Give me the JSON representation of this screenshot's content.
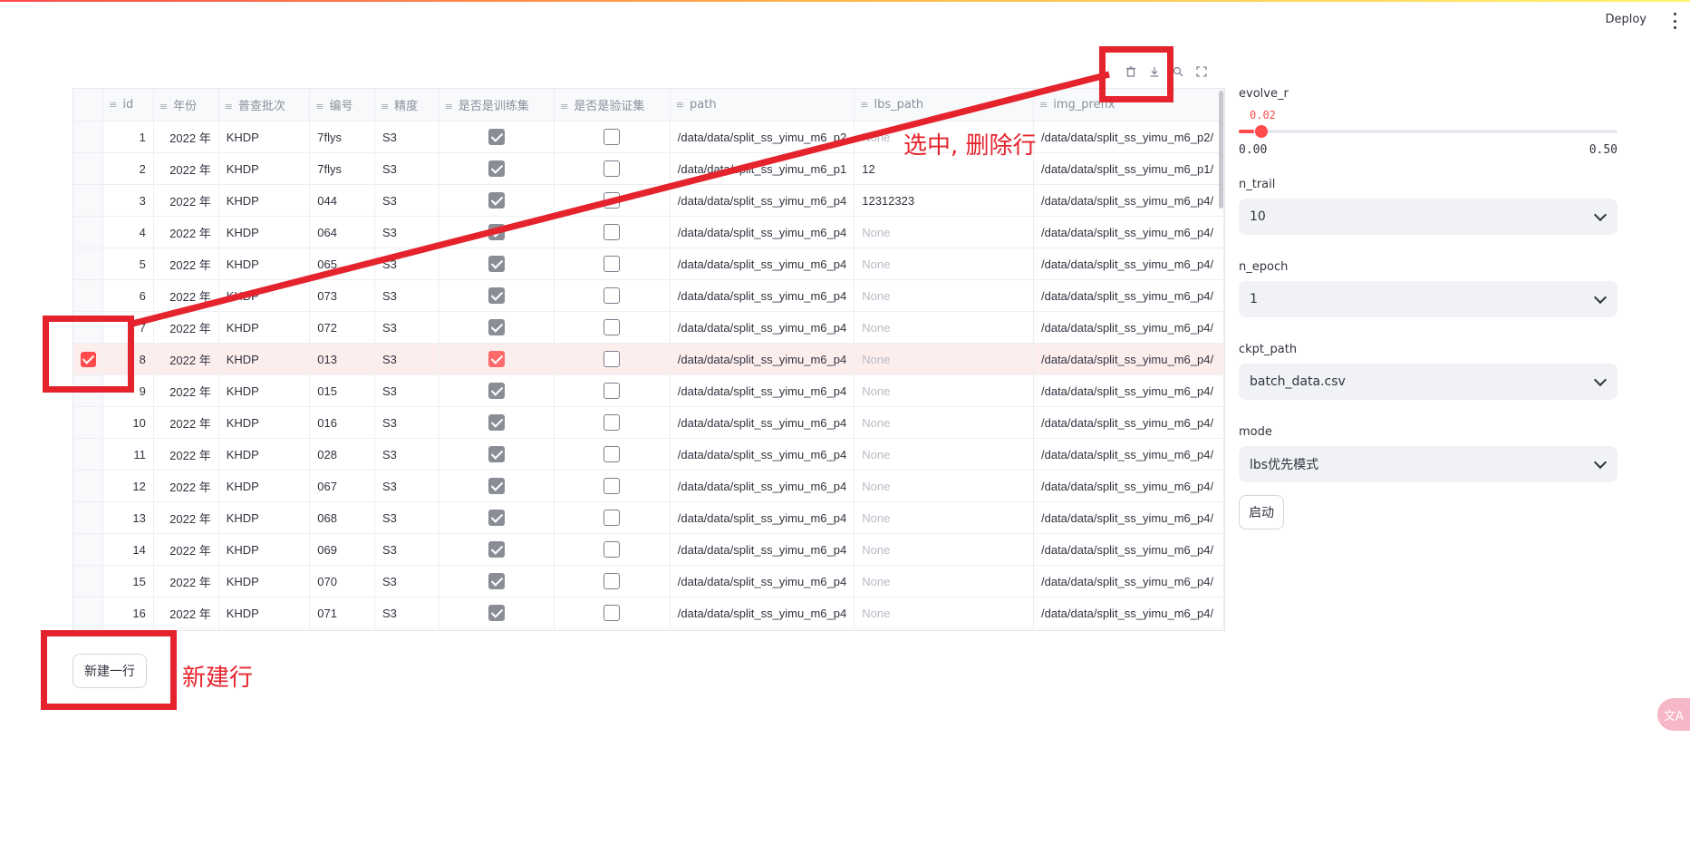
{
  "header": {
    "deploy_label": "Deploy"
  },
  "table": {
    "columns": [
      "id",
      "年份",
      "普查批次",
      "编号",
      "精度",
      "是否是训练集",
      "是否是验证集",
      "path",
      "lbs_path",
      "img_prefix"
    ],
    "rows": [
      {
        "id": "1",
        "year": "2022 年",
        "batch": "KHDP",
        "code": "7flys",
        "acc": "S3",
        "train": true,
        "val": false,
        "path": "/data/data/split_ss_yimu_m6_p2",
        "lbs": "None",
        "img": "/data/data/split_ss_yimu_m6_p2/"
      },
      {
        "id": "2",
        "year": "2022 年",
        "batch": "KHDP",
        "code": "7flys",
        "acc": "S3",
        "train": true,
        "val": false,
        "path": "/data/data/split_ss_yimu_m6_p1",
        "lbs": "12",
        "img": "/data/data/split_ss_yimu_m6_p1/"
      },
      {
        "id": "3",
        "year": "2022 年",
        "batch": "KHDP",
        "code": "044",
        "acc": "S3",
        "train": true,
        "val": false,
        "path": "/data/data/split_ss_yimu_m6_p4",
        "lbs": "12312323",
        "img": "/data/data/split_ss_yimu_m6_p4/"
      },
      {
        "id": "4",
        "year": "2022 年",
        "batch": "KHDP",
        "code": "064",
        "acc": "S3",
        "train": true,
        "val": false,
        "path": "/data/data/split_ss_yimu_m6_p4",
        "lbs": "None",
        "img": "/data/data/split_ss_yimu_m6_p4/"
      },
      {
        "id": "5",
        "year": "2022 年",
        "batch": "KHDP",
        "code": "065",
        "acc": "S3",
        "train": true,
        "val": false,
        "path": "/data/data/split_ss_yimu_m6_p4",
        "lbs": "None",
        "img": "/data/data/split_ss_yimu_m6_p4/"
      },
      {
        "id": "6",
        "year": "2022 年",
        "batch": "KHDP",
        "code": "073",
        "acc": "S3",
        "train": true,
        "val": false,
        "path": "/data/data/split_ss_yimu_m6_p4",
        "lbs": "None",
        "img": "/data/data/split_ss_yimu_m6_p4/"
      },
      {
        "id": "7",
        "year": "2022 年",
        "batch": "KHDP",
        "code": "072",
        "acc": "S3",
        "train": true,
        "val": false,
        "path": "/data/data/split_ss_yimu_m6_p4",
        "lbs": "None",
        "img": "/data/data/split_ss_yimu_m6_p4/"
      },
      {
        "id": "8",
        "year": "2022 年",
        "batch": "KHDP",
        "code": "013",
        "acc": "S3",
        "train": true,
        "val": false,
        "path": "/data/data/split_ss_yimu_m6_p4",
        "lbs": "None",
        "img": "/data/data/split_ss_yimu_m6_p4/"
      },
      {
        "id": "9",
        "year": "2022 年",
        "batch": "KHDP",
        "code": "015",
        "acc": "S3",
        "train": true,
        "val": false,
        "path": "/data/data/split_ss_yimu_m6_p4",
        "lbs": "None",
        "img": "/data/data/split_ss_yimu_m6_p4/"
      },
      {
        "id": "10",
        "year": "2022 年",
        "batch": "KHDP",
        "code": "016",
        "acc": "S3",
        "train": true,
        "val": false,
        "path": "/data/data/split_ss_yimu_m6_p4",
        "lbs": "None",
        "img": "/data/data/split_ss_yimu_m6_p4/"
      },
      {
        "id": "11",
        "year": "2022 年",
        "batch": "KHDP",
        "code": "028",
        "acc": "S3",
        "train": true,
        "val": false,
        "path": "/data/data/split_ss_yimu_m6_p4",
        "lbs": "None",
        "img": "/data/data/split_ss_yimu_m6_p4/"
      },
      {
        "id": "12",
        "year": "2022 年",
        "batch": "KHDP",
        "code": "067",
        "acc": "S3",
        "train": true,
        "val": false,
        "path": "/data/data/split_ss_yimu_m6_p4",
        "lbs": "None",
        "img": "/data/data/split_ss_yimu_m6_p4/"
      },
      {
        "id": "13",
        "year": "2022 年",
        "batch": "KHDP",
        "code": "068",
        "acc": "S3",
        "train": true,
        "val": false,
        "path": "/data/data/split_ss_yimu_m6_p4",
        "lbs": "None",
        "img": "/data/data/split_ss_yimu_m6_p4/"
      },
      {
        "id": "14",
        "year": "2022 年",
        "batch": "KHDP",
        "code": "069",
        "acc": "S3",
        "train": true,
        "val": false,
        "path": "/data/data/split_ss_yimu_m6_p4",
        "lbs": "None",
        "img": "/data/data/split_ss_yimu_m6_p4/"
      },
      {
        "id": "15",
        "year": "2022 年",
        "batch": "KHDP",
        "code": "070",
        "acc": "S3",
        "train": true,
        "val": false,
        "path": "/data/data/split_ss_yimu_m6_p4",
        "lbs": "None",
        "img": "/data/data/split_ss_yimu_m6_p4/"
      },
      {
        "id": "16",
        "year": "2022 年",
        "batch": "KHDP",
        "code": "071",
        "acc": "S3",
        "train": true,
        "val": false,
        "path": "/data/data/split_ss_yimu_m6_p4",
        "lbs": "None",
        "img": "/data/data/split_ss_yimu_m6_p4/"
      }
    ],
    "selected_row_id": "8",
    "toolbar_icons": [
      "trash-icon",
      "download-icon",
      "search-icon",
      "fullscreen-icon"
    ]
  },
  "new_row_button": "新建一行",
  "controls": {
    "slider": {
      "label": "evolve_r",
      "value": "0.02",
      "min": "0.00",
      "max": "0.50",
      "fraction": 0.04
    },
    "n_trail": {
      "label": "n_trail",
      "value": "10"
    },
    "n_epoch": {
      "label": "n_epoch",
      "value": "1"
    },
    "ckpt_path": {
      "label": "ckpt_path",
      "value": "batch_data.csv"
    },
    "mode": {
      "label": "mode",
      "value": "lbs优先模式"
    },
    "start_button": "启动"
  },
  "annotations": {
    "select_delete": "选中, 删除行",
    "new_row": "新建行",
    "color": "#e5232d"
  },
  "colors": {
    "accent": "#ff4b4b",
    "selected_row": "#fdeeee"
  }
}
